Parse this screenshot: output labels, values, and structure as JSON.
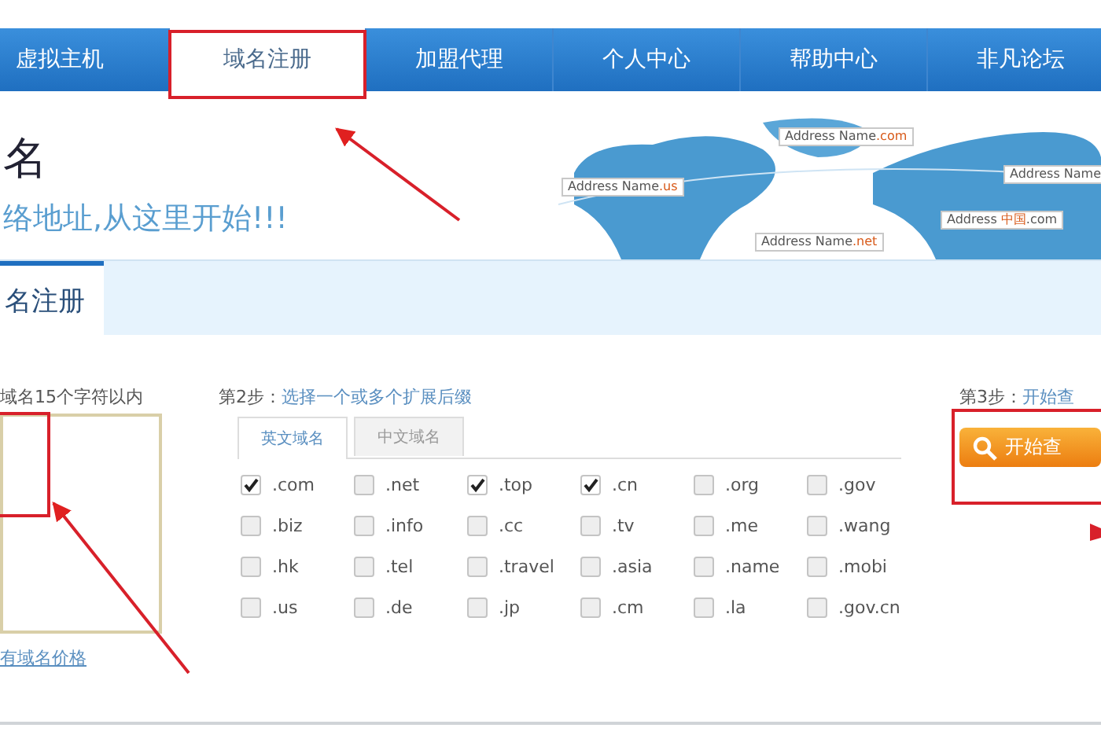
{
  "nav": [
    {
      "label": "虚拟主机",
      "selected": false
    },
    {
      "label": "域名注册",
      "selected": true
    },
    {
      "label": "加盟代理",
      "selected": false
    },
    {
      "label": "个人中心",
      "selected": false
    },
    {
      "label": "帮助中心",
      "selected": false
    },
    {
      "label": "非凡论坛",
      "selected": false
    }
  ],
  "banner": {
    "title": "名",
    "subtitle": "络地址,从这里开始!!!",
    "map_labels": [
      {
        "prefix": "Address",
        "name": "Name",
        "suffix": ".com"
      },
      {
        "prefix": "Address",
        "name": "Name",
        "suffix": ".us"
      },
      {
        "prefix": "Address",
        "name": "Name"
      },
      {
        "prefix": "Address",
        "suffix": "中国",
        "tail": ".com"
      },
      {
        "prefix": "Address",
        "name": "Name",
        "suffix": ".net"
      }
    ]
  },
  "section_tab": {
    "label": "名注册"
  },
  "step1": {
    "label": "域名15个字符以内",
    "link": "有域名价格"
  },
  "step2": {
    "label": "第2步：",
    "hint": "选择一个或多个扩展后缀",
    "tabs": [
      {
        "label": "英文域名",
        "selected": true
      },
      {
        "label": "中文域名",
        "selected": false
      }
    ],
    "extensions": [
      {
        "label": ".com",
        "checked": true
      },
      {
        "label": ".net",
        "checked": false
      },
      {
        "label": ".top",
        "checked": true
      },
      {
        "label": ".cn",
        "checked": true
      },
      {
        "label": ".org",
        "checked": false
      },
      {
        "label": ".gov",
        "checked": false
      },
      {
        "label": ".biz",
        "checked": false
      },
      {
        "label": ".info",
        "checked": false
      },
      {
        "label": ".cc",
        "checked": false
      },
      {
        "label": ".tv",
        "checked": false
      },
      {
        "label": ".me",
        "checked": false
      },
      {
        "label": ".wang",
        "checked": false
      },
      {
        "label": ".hk",
        "checked": false
      },
      {
        "label": ".tel",
        "checked": false
      },
      {
        "label": ".travel",
        "checked": false
      },
      {
        "label": ".asia",
        "checked": false
      },
      {
        "label": ".name",
        "checked": false
      },
      {
        "label": ".mobi",
        "checked": false
      },
      {
        "label": ".us",
        "checked": false
      },
      {
        "label": ".de",
        "checked": false
      },
      {
        "label": ".jp",
        "checked": false
      },
      {
        "label": ".cm",
        "checked": false
      },
      {
        "label": ".la",
        "checked": false
      },
      {
        "label": ".gov.cn",
        "checked": false
      }
    ]
  },
  "step3": {
    "label": "第3步：",
    "hint": "开始查",
    "button": "开始查"
  }
}
